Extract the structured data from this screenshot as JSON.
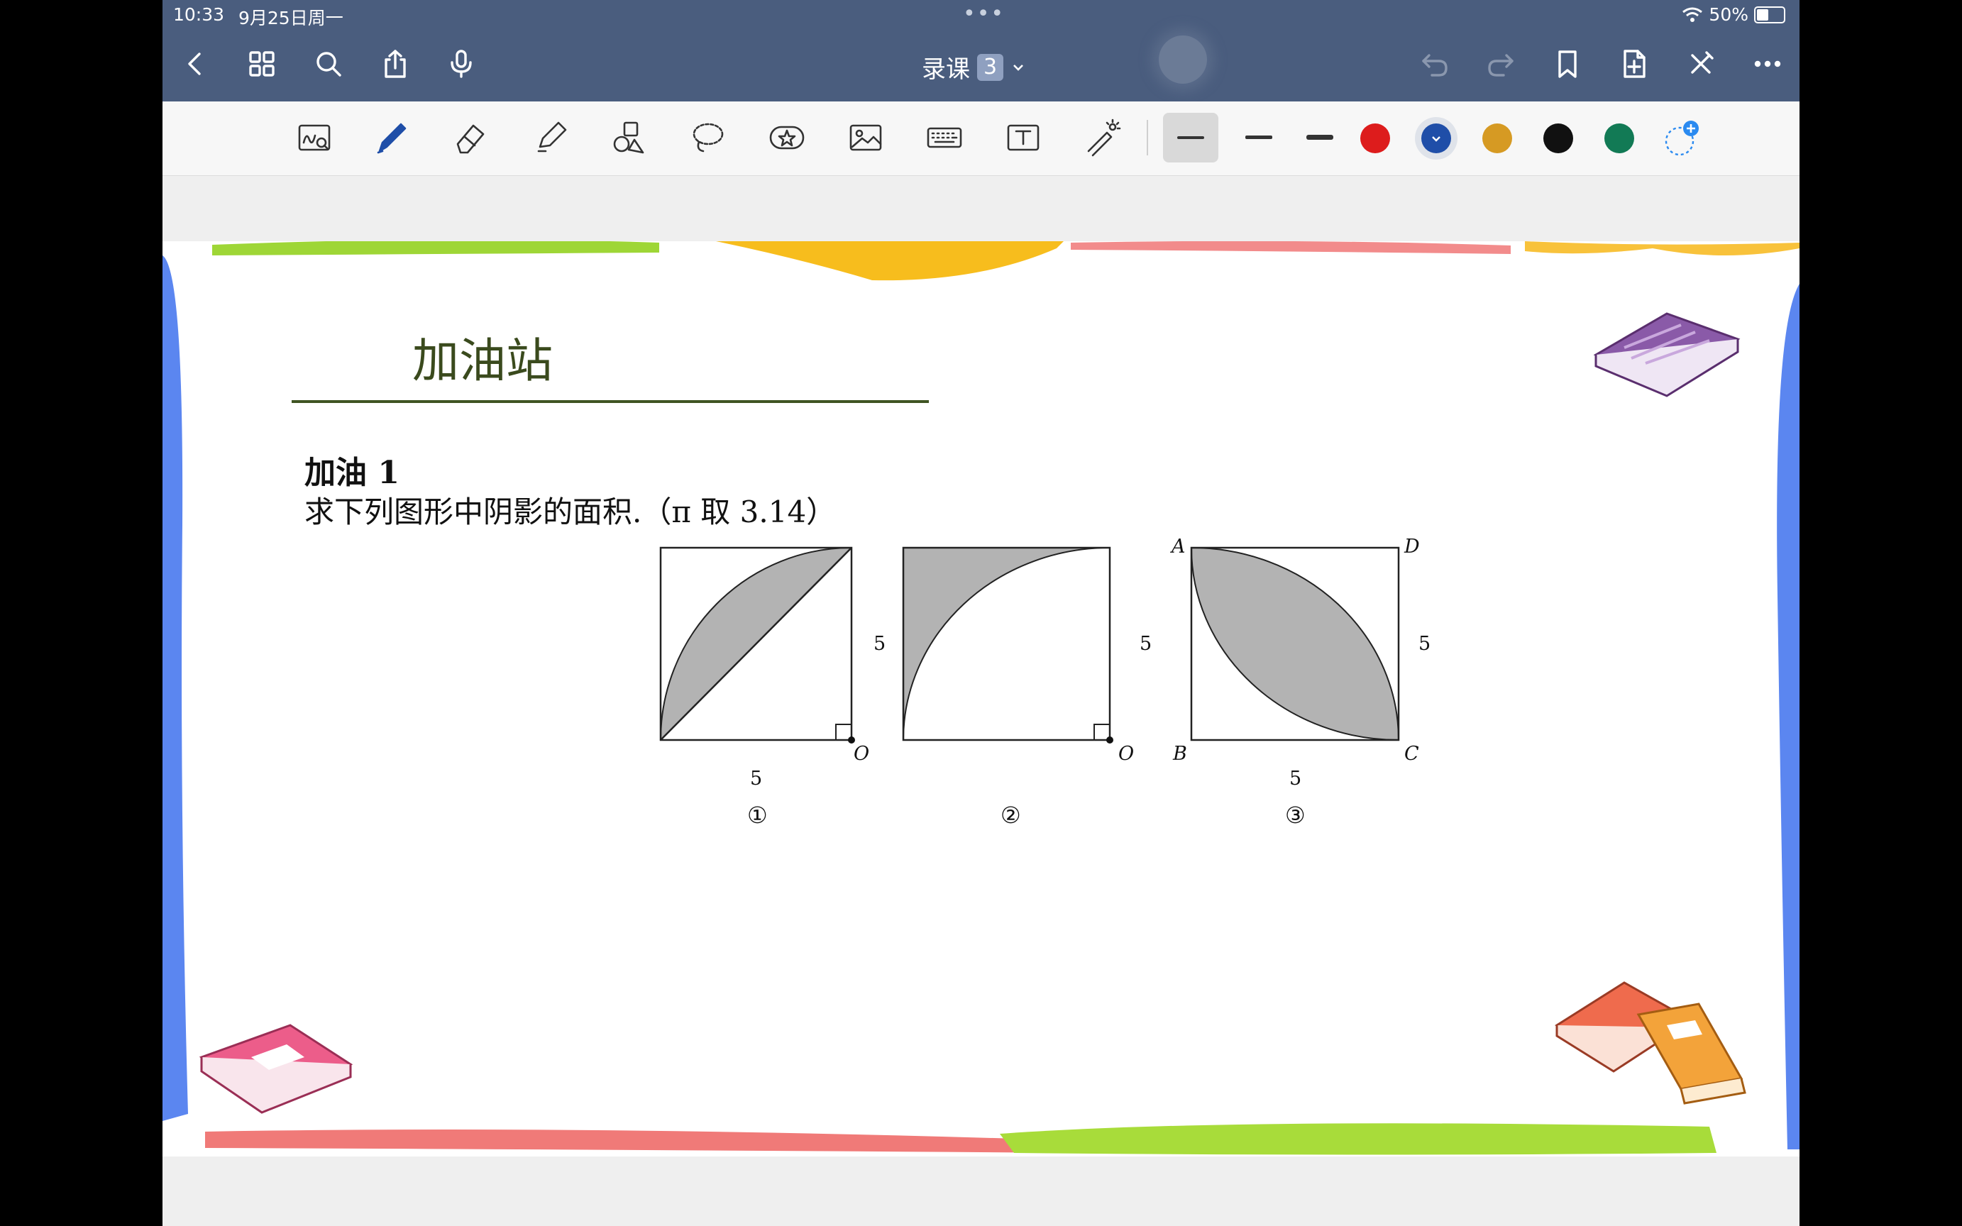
{
  "status_bar": {
    "time": "10:33",
    "date": "9月25日周一",
    "dots": "•••",
    "battery": "50%"
  },
  "nav": {
    "doc_title": "录课",
    "doc_badge": "3"
  },
  "palette": {
    "accent_toolbar": "#4a5d7e",
    "swatches": [
      {
        "name": "red",
        "color": "#dd1c1c"
      },
      {
        "name": "blue",
        "color": "#1f4ea8",
        "selected": true
      },
      {
        "name": "gold",
        "color": "#d69a23"
      },
      {
        "name": "black",
        "color": "#111111"
      },
      {
        "name": "green",
        "color": "#127a55"
      }
    ]
  },
  "slide": {
    "title": "加油站",
    "problem_heading": "加油 1",
    "problem_text": "求下列图形中阴影的面积.（π 取 3.14）",
    "figures": [
      {
        "index": "①",
        "side_label": "5",
        "bottom_label": "5",
        "corner_label": "O"
      },
      {
        "index": "②",
        "side_label": "5",
        "corner_label": "O"
      },
      {
        "index": "③",
        "side_label": "5",
        "bottom_label": "5",
        "corner_labels": {
          "A": "A",
          "D": "D",
          "B": "B",
          "C": "C"
        }
      }
    ]
  }
}
